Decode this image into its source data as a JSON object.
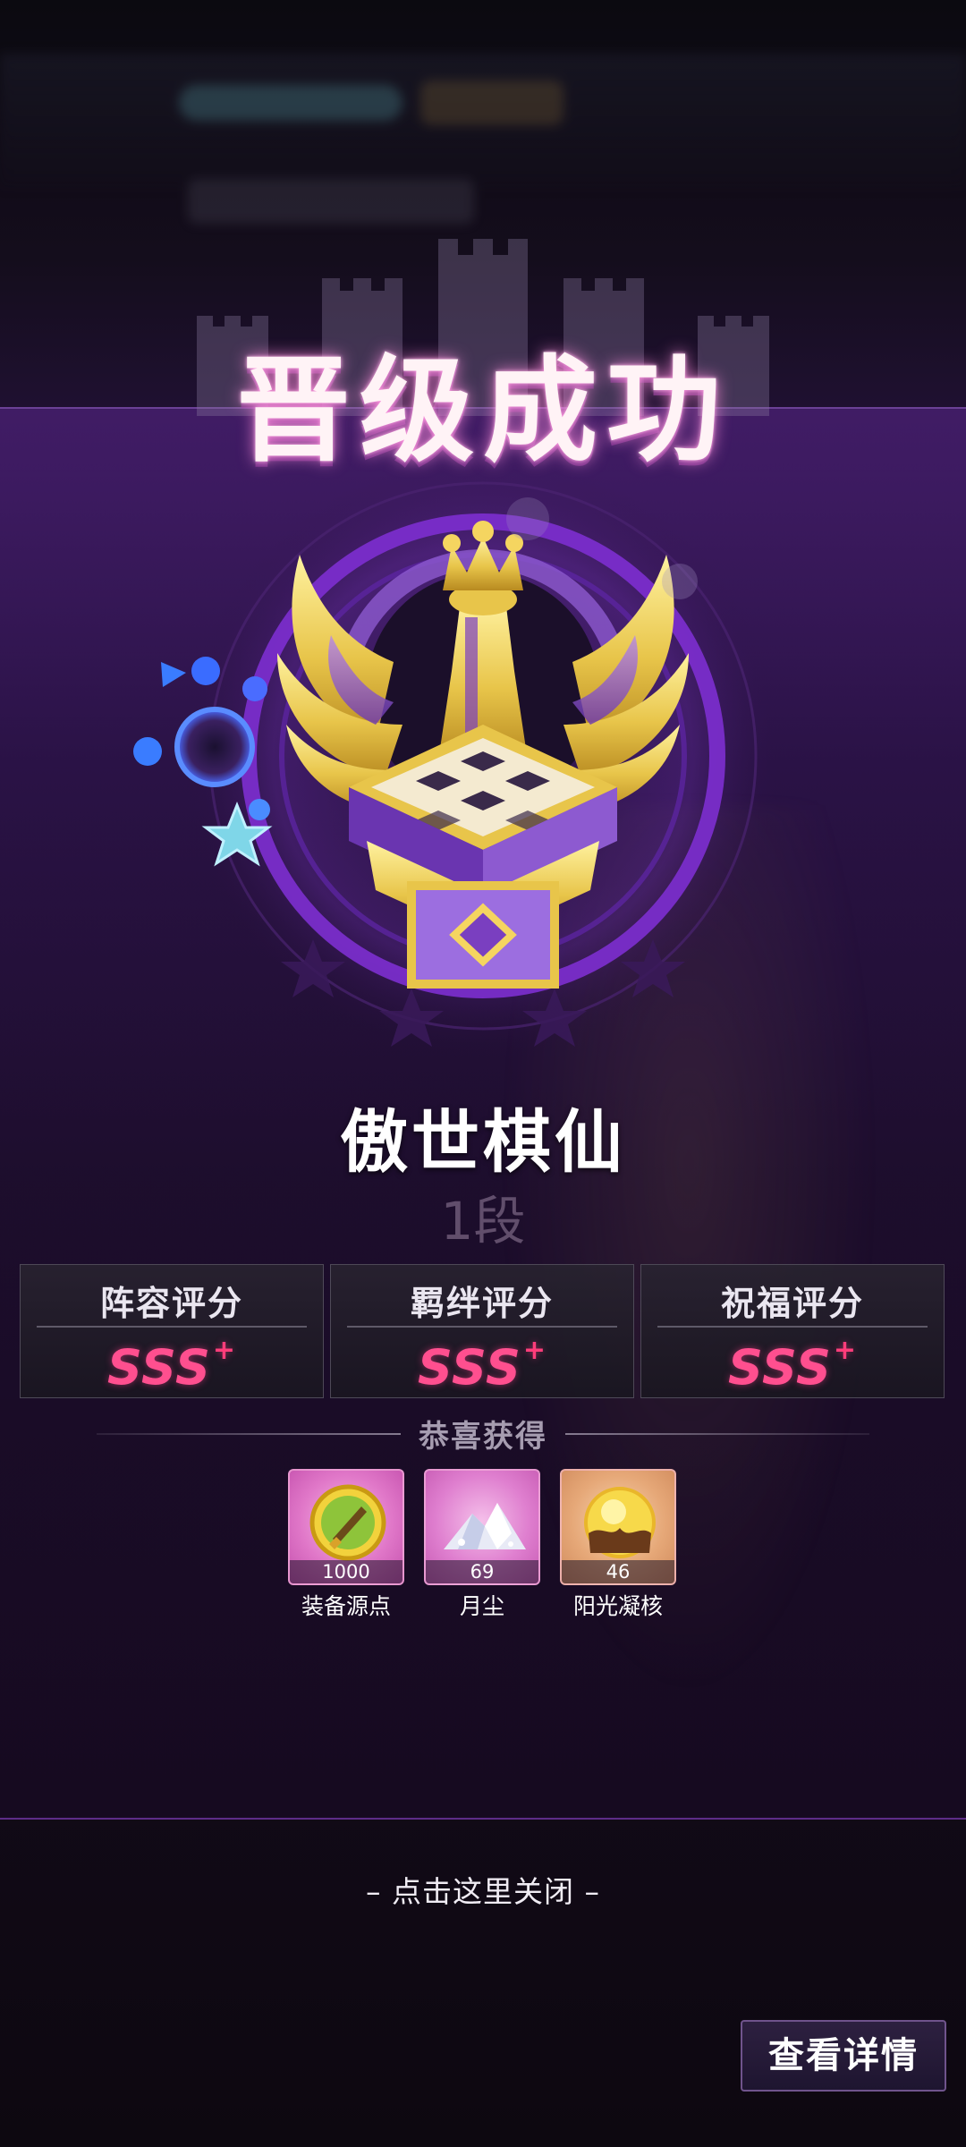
{
  "popup": {
    "title": "晋级成功",
    "rank_name": "傲世棋仙",
    "rank_tier": "1段",
    "emblem_icon": "winged-crown-chess-emblem-icon"
  },
  "scores": [
    {
      "label": "阵容评分",
      "grade": "SSS",
      "plus": "+"
    },
    {
      "label": "羁绊评分",
      "grade": "SSS",
      "plus": "+"
    },
    {
      "label": "祝福评分",
      "grade": "SSS",
      "plus": "+"
    }
  ],
  "rewards": {
    "heading": "恭喜获得",
    "items": [
      {
        "name": "装备源点",
        "count": "1000",
        "icon": "gold-sword-coin-icon"
      },
      {
        "name": "月尘",
        "count": "69",
        "icon": "moon-dust-crystal-icon"
      },
      {
        "name": "阳光凝核",
        "count": "46",
        "icon": "sunlight-core-orb-icon"
      }
    ]
  },
  "close_hint": "– 点击这里关闭 –",
  "detail_button": "查看详情",
  "colors": {
    "grade": "#ff4f8f",
    "accent_purple": "#7a3fc0",
    "gold": "#e8c54a"
  }
}
